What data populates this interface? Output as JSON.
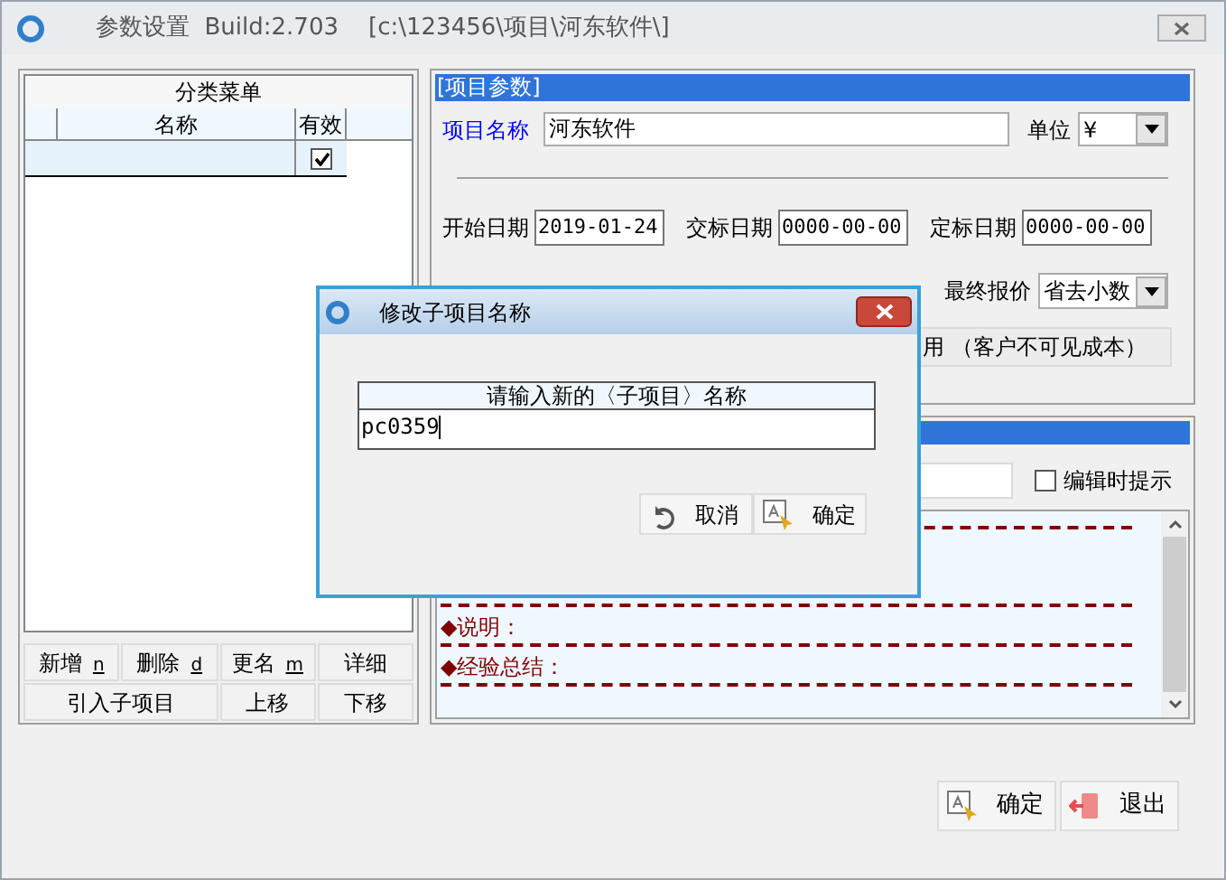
{
  "window": {
    "title": "参数设置  Build:2.703    [c:\\123456\\项目\\河东软件\\]"
  },
  "category_menu": {
    "title": "分类菜单",
    "columns": [
      "名称",
      "有效"
    ],
    "rows": [
      {
        "selected": true,
        "enabled": true
      }
    ]
  },
  "menu_buttons": [
    {
      "label": "新增",
      "shortcut": "n",
      "kind": "normal"
    },
    {
      "label": "删除",
      "shortcut": "d",
      "kind": "normal"
    },
    {
      "label": "更名",
      "shortcut": "m",
      "kind": "normal"
    },
    {
      "label": "详细",
      "kind": "normal"
    },
    {
      "label": "引入子项目",
      "kind": "wide"
    },
    {
      "label": "上移",
      "kind": "normal"
    },
    {
      "label": "下移",
      "kind": "normal"
    }
  ],
  "project_params": {
    "title": "[项目参数]",
    "name_label": "项目名称",
    "name_value": "河东软件",
    "unit_label": "单位",
    "unit_value": "¥",
    "dates": [
      {
        "label": "开始日期",
        "value": "2019-01-24"
      },
      {
        "label": "交标日期",
        "value": "0000-00-00"
      },
      {
        "label": "定标日期",
        "value": "0000-00-00"
      }
    ],
    "final_price_label": "最终报价",
    "final_price_value": "省去小数",
    "cost_option": "用 （客户不可见成本）"
  },
  "notes": {
    "edit_prompt": {
      "label": "编辑时提示",
      "checked": false
    },
    "sections": [
      "◆说明：",
      "◆经验总结："
    ]
  },
  "footer_buttons": [
    {
      "label": "确定",
      "kind": "confirm"
    },
    {
      "label": "退出",
      "kind": "exit"
    }
  ],
  "dialog": {
    "title": "修改子项目名称",
    "prompt": "请输入新的〈子项目〉名称",
    "value": "pc0359",
    "buttons": [
      {
        "label": "取消",
        "kind": "cancel"
      },
      {
        "label": "确定",
        "kind": "confirm"
      }
    ]
  }
}
